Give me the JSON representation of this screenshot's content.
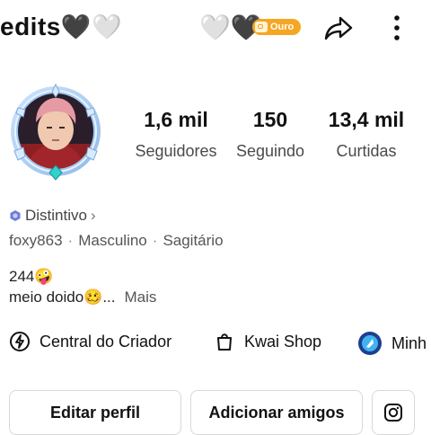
{
  "header": {
    "title": "edits",
    "title_hearts": "🖤🤍",
    "status_hearts": "🤍🖤",
    "badge_label": "Ouro",
    "badge_color": "#f5a623"
  },
  "profile": {
    "stats": [
      {
        "value": "1,6 mil",
        "label": "Seguidores"
      },
      {
        "value": "150",
        "label": "Seguindo"
      },
      {
        "value": "13,4 mil",
        "label": "Curtidas"
      }
    ],
    "distintivo_label": "Distintivo",
    "distintivo_chevron": "›",
    "username": "foxy863",
    "gender": "Masculino",
    "sign": "Sagitário",
    "separator": "·",
    "bio_line1": "244🤪",
    "bio_line2": "meio doido🥴...",
    "bio_more": "Mais"
  },
  "shortcuts": [
    {
      "label": "Central do Criador",
      "icon": "lightning-icon"
    },
    {
      "label": "Kwai Shop",
      "icon": "shopping-bag-icon"
    },
    {
      "label": "Minh",
      "icon": "game-badge-icon"
    }
  ],
  "actions": {
    "edit_label": "Editar perfil",
    "add_friends_label": "Adicionar amigos",
    "instagram_icon": "instagram-icon"
  }
}
